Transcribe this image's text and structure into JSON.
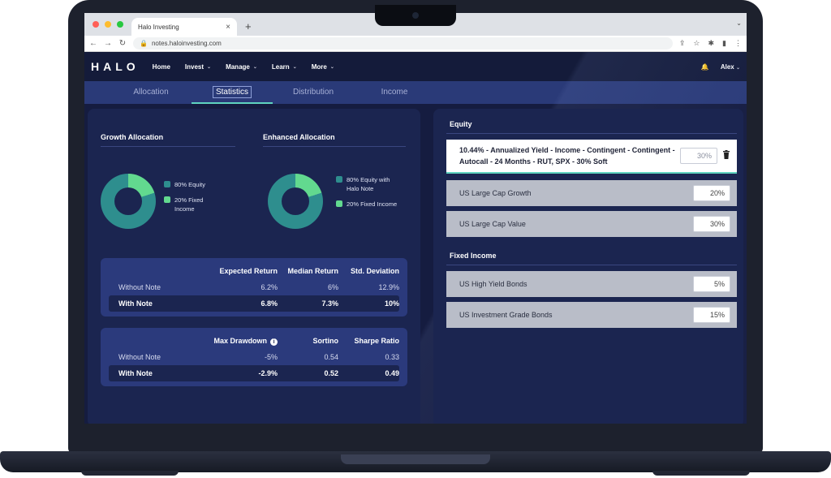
{
  "browser": {
    "tab_title": "Halo Investing",
    "tab_close": "×",
    "new_tab": "+",
    "tabs_menu": "⌄",
    "url": "notes.haloinvesting.com",
    "colors": {
      "red": "#ff5f57",
      "yellow": "#febc2e",
      "green": "#28c840"
    }
  },
  "nav": {
    "logo": "HALO",
    "items": [
      {
        "label": "Home",
        "caret": ""
      },
      {
        "label": "Invest",
        "caret": "⌄"
      },
      {
        "label": "Manage",
        "caret": "⌄"
      },
      {
        "label": "Learn",
        "caret": "⌄"
      },
      {
        "label": "More",
        "caret": "⌄"
      }
    ],
    "user": "Alex",
    "user_caret": "⌄"
  },
  "subtabs": [
    "Allocation",
    "Statistics",
    "Distribution",
    "Income"
  ],
  "left": {
    "growth": {
      "title": "Growth Allocation",
      "legend": [
        {
          "label": "80% Equity",
          "color": "#2e8e8e"
        },
        {
          "label": "20% Fixed Income",
          "color": "#62d98f"
        }
      ],
      "equity_pct": 80
    },
    "enhanced": {
      "title": "Enhanced Allocation",
      "legend": [
        {
          "label": "80% Equity with Halo Note",
          "color": "#2e8e8e"
        },
        {
          "label": "20% Fixed Income",
          "color": "#62d98f"
        }
      ],
      "equity_pct": 80
    },
    "table1": {
      "headers": [
        "",
        "Expected Return",
        "Median Return",
        "Std. Deviation"
      ],
      "rows": [
        [
          "Without Note",
          "6.2%",
          "6%",
          "12.9%"
        ],
        [
          "With Note",
          "6.8%",
          "7.3%",
          "10%"
        ]
      ]
    },
    "table2": {
      "headers": [
        "",
        "Max Drawdown",
        "Sortino",
        "Sharpe Ratio"
      ],
      "info": "i",
      "rows": [
        [
          "Without Note",
          "-5%",
          "0.54",
          "0.33"
        ],
        [
          "With Note",
          "-2.9%",
          "0.52",
          "0.49"
        ]
      ]
    }
  },
  "right": {
    "equity_title": "Equity",
    "note_card": {
      "title": "10.44% - Annualized Yield - Income - Contingent - Contingent - Autocall - 24 Months - RUT, SPX - 30% Soft",
      "pct": "30%"
    },
    "equity_items": [
      {
        "label": "US Large Cap Growth",
        "pct": "20%"
      },
      {
        "label": "US Large Cap Value",
        "pct": "30%"
      }
    ],
    "fixed_title": "Fixed Income",
    "fixed_items": [
      {
        "label": "US High Yield Bonds",
        "pct": "5%"
      },
      {
        "label": "US Investment Grade Bonds",
        "pct": "15%"
      }
    ]
  }
}
